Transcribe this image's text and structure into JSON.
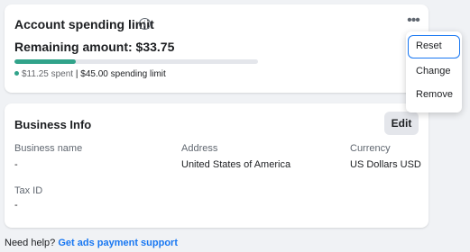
{
  "spending": {
    "title": "Account spending limit",
    "info_icon": "info-icon",
    "more_icon": "more-horizontal-icon",
    "remaining_label": "Remaining amount: $33.75",
    "spent_text": "$11.25 spent",
    "separator": "|",
    "limit_text": "$45.00 spending limit",
    "progress_fraction": 0.25,
    "progress_color": "#31a38a"
  },
  "menu": {
    "items": [
      {
        "label": "Reset"
      },
      {
        "label": "Change"
      },
      {
        "label": "Remove"
      }
    ]
  },
  "business": {
    "title": "Business Info",
    "edit_label": "Edit",
    "fields": [
      {
        "label": "Business name",
        "value": "-"
      },
      {
        "label": "Address",
        "value": "United States of America"
      },
      {
        "label": "Currency",
        "value": "US Dollars USD"
      },
      {
        "label": "Tax ID",
        "value": "-"
      }
    ]
  },
  "footer": {
    "prompt": "Need help?",
    "link": "Get ads payment support"
  },
  "colors": {
    "accent": "#1877f2",
    "progress": "#31a38a",
    "background": "#f0f2f5"
  }
}
